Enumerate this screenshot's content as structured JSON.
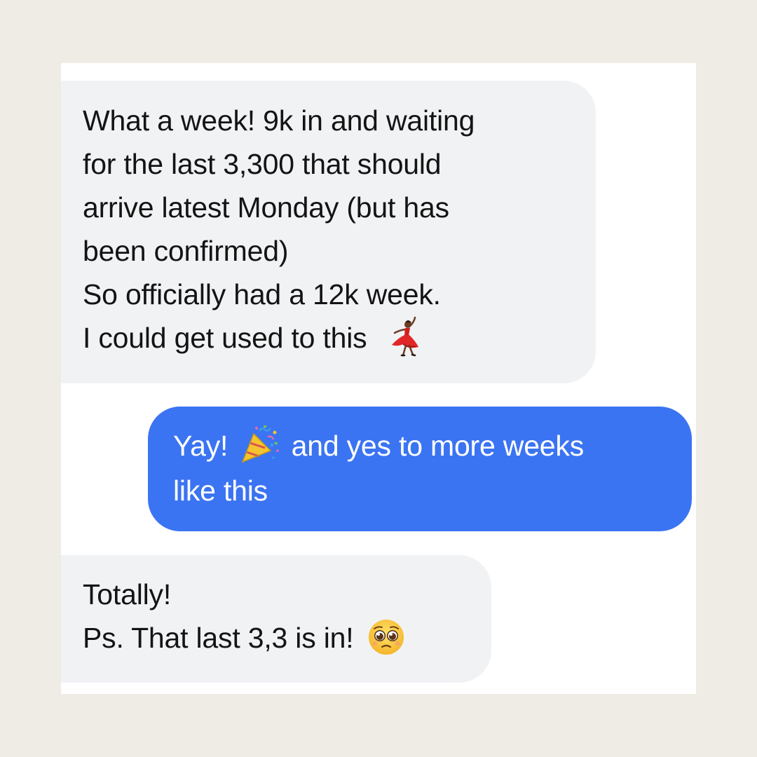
{
  "messages": [
    {
      "direction": "incoming",
      "lines": [
        "What a week! 9k in and waiting",
        "for the last 3,300 that should",
        "arrive latest Monday (but has",
        "been confirmed)",
        "So officially had a 12k week.",
        "I could get used to this"
      ],
      "emoji": "dancing-woman-emoji"
    },
    {
      "direction": "outgoing",
      "line1_before": "Yay!",
      "line1_emoji": "party-popper-emoji",
      "line1_after": "and yes to more weeks",
      "line2": "like this"
    },
    {
      "direction": "incoming",
      "lines": [
        "Totally!",
        "Ps. That last 3,3 is in!"
      ],
      "emoji": "pleading-face-emoji"
    }
  ],
  "colors": {
    "page_background": "#efece5",
    "card_background": "#ffffff",
    "incoming_bubble": "#f1f2f4",
    "outgoing_bubble": "#3b74f2",
    "incoming_text": "#141414",
    "outgoing_text": "#ffffff"
  }
}
